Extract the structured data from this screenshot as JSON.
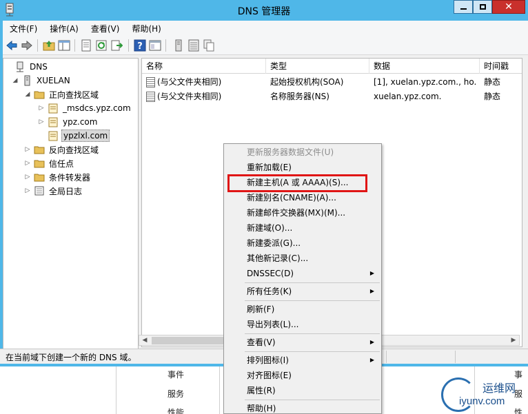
{
  "window": {
    "title": "DNS 管理器"
  },
  "menubar": [
    "文件(F)",
    "操作(A)",
    "查看(V)",
    "帮助(H)"
  ],
  "toolbar": [
    "back-icon",
    "forward-icon",
    "up-folder-icon",
    "show-tree-icon",
    "properties-icon",
    "refresh-icon",
    "export-icon",
    "help-icon",
    "view-icon",
    "server-icon",
    "list-icon",
    "copy-icon"
  ],
  "tree": {
    "root": "DNS",
    "server": "XUELAN",
    "forward_zones": "正向查找区域",
    "zones": [
      "_msdcs.ypz.com",
      "ypz.com",
      "ypzlxl.com"
    ],
    "reverse_zones": "反向查找区域",
    "trust_points": "信任点",
    "conditional_forwarders": "条件转发器",
    "global_logs": "全局日志"
  },
  "list": {
    "columns": [
      "名称",
      "类型",
      "数据",
      "时间戳"
    ],
    "rows": [
      {
        "name": "(与父文件夹相同)",
        "type": "起始授权机构(SOA)",
        "data": "[1], xuelan.ypz.com., ho...",
        "time": "静态"
      },
      {
        "name": "(与父文件夹相同)",
        "type": "名称服务器(NS)",
        "data": "xuelan.ypz.com.",
        "time": "静态"
      }
    ]
  },
  "status": "在当前域下创建一个新的 DNS 域。",
  "context_menu": [
    {
      "label": "更新服务器数据文件(U)",
      "disabled": true
    },
    {
      "label": "重新加载(E)"
    },
    {
      "label": "新建主机(A 或 AAAA)(S)...",
      "highlighted": true
    },
    {
      "label": "新建别名(CNAME)(A)..."
    },
    {
      "label": "新建邮件交换器(MX)(M)..."
    },
    {
      "label": "新建域(O)..."
    },
    {
      "label": "新建委派(G)..."
    },
    {
      "label": "其他新记录(C)..."
    },
    {
      "label": "DNSSEC(D)",
      "submenu": true
    },
    {
      "label": "所有任务(K)",
      "submenu": true
    },
    {
      "label": "刷新(F)"
    },
    {
      "label": "导出列表(L)..."
    },
    {
      "label": "查看(V)",
      "submenu": true
    },
    {
      "label": "排列图标(I)",
      "submenu": true
    },
    {
      "label": "对齐图标(E)"
    },
    {
      "label": "属性(R)"
    },
    {
      "label": "帮助(H)"
    }
  ],
  "background": {
    "items": [
      "事件",
      "服务",
      "性能"
    ],
    "right_items": [
      "事",
      "服",
      "性"
    ],
    "watermark": {
      "line1": "运维网",
      "line2": "iyunv.com"
    }
  },
  "colors": {
    "titlebar": "#4fb7e8",
    "close": "#c9302c",
    "highlight_box": "#e01515"
  }
}
